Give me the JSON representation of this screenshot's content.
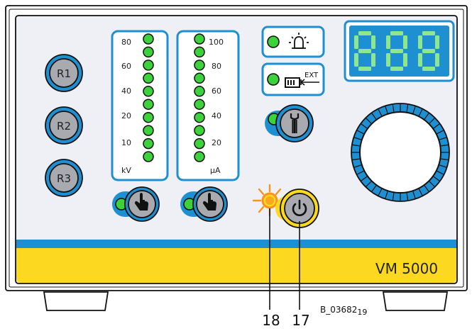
{
  "device": {
    "model": "VM 5000",
    "figure_code": "B_03682",
    "figure_code_sub": "19"
  },
  "presets": [
    "R1",
    "R2",
    "R3"
  ],
  "kv_meter": {
    "ticks": [
      "80",
      "60",
      "40",
      "20",
      "10"
    ],
    "unit": "kV",
    "led_count": 10
  },
  "ua_meter": {
    "ticks": [
      "100",
      "80",
      "60",
      "40",
      "20"
    ],
    "unit": "µA",
    "led_count": 10
  },
  "ext_label": "EXT",
  "display": {
    "digits": "888"
  },
  "callouts": [
    "18",
    "17"
  ],
  "colors": {
    "panel": "#eef0f5",
    "accent_blue": "#1e90d2",
    "accent_yellow": "#fcd820",
    "led_green": "#3bd23b",
    "button_grey": "#a8aab0",
    "display_bg": "#1e90d2",
    "display_seg": "#8fe68f",
    "warning_orange": "#f7931e"
  },
  "icons": [
    "bell-alarm-icon",
    "ext-interlock-icon",
    "wrench-icon",
    "hand-press-icon",
    "power-icon",
    "rotary-knob"
  ]
}
